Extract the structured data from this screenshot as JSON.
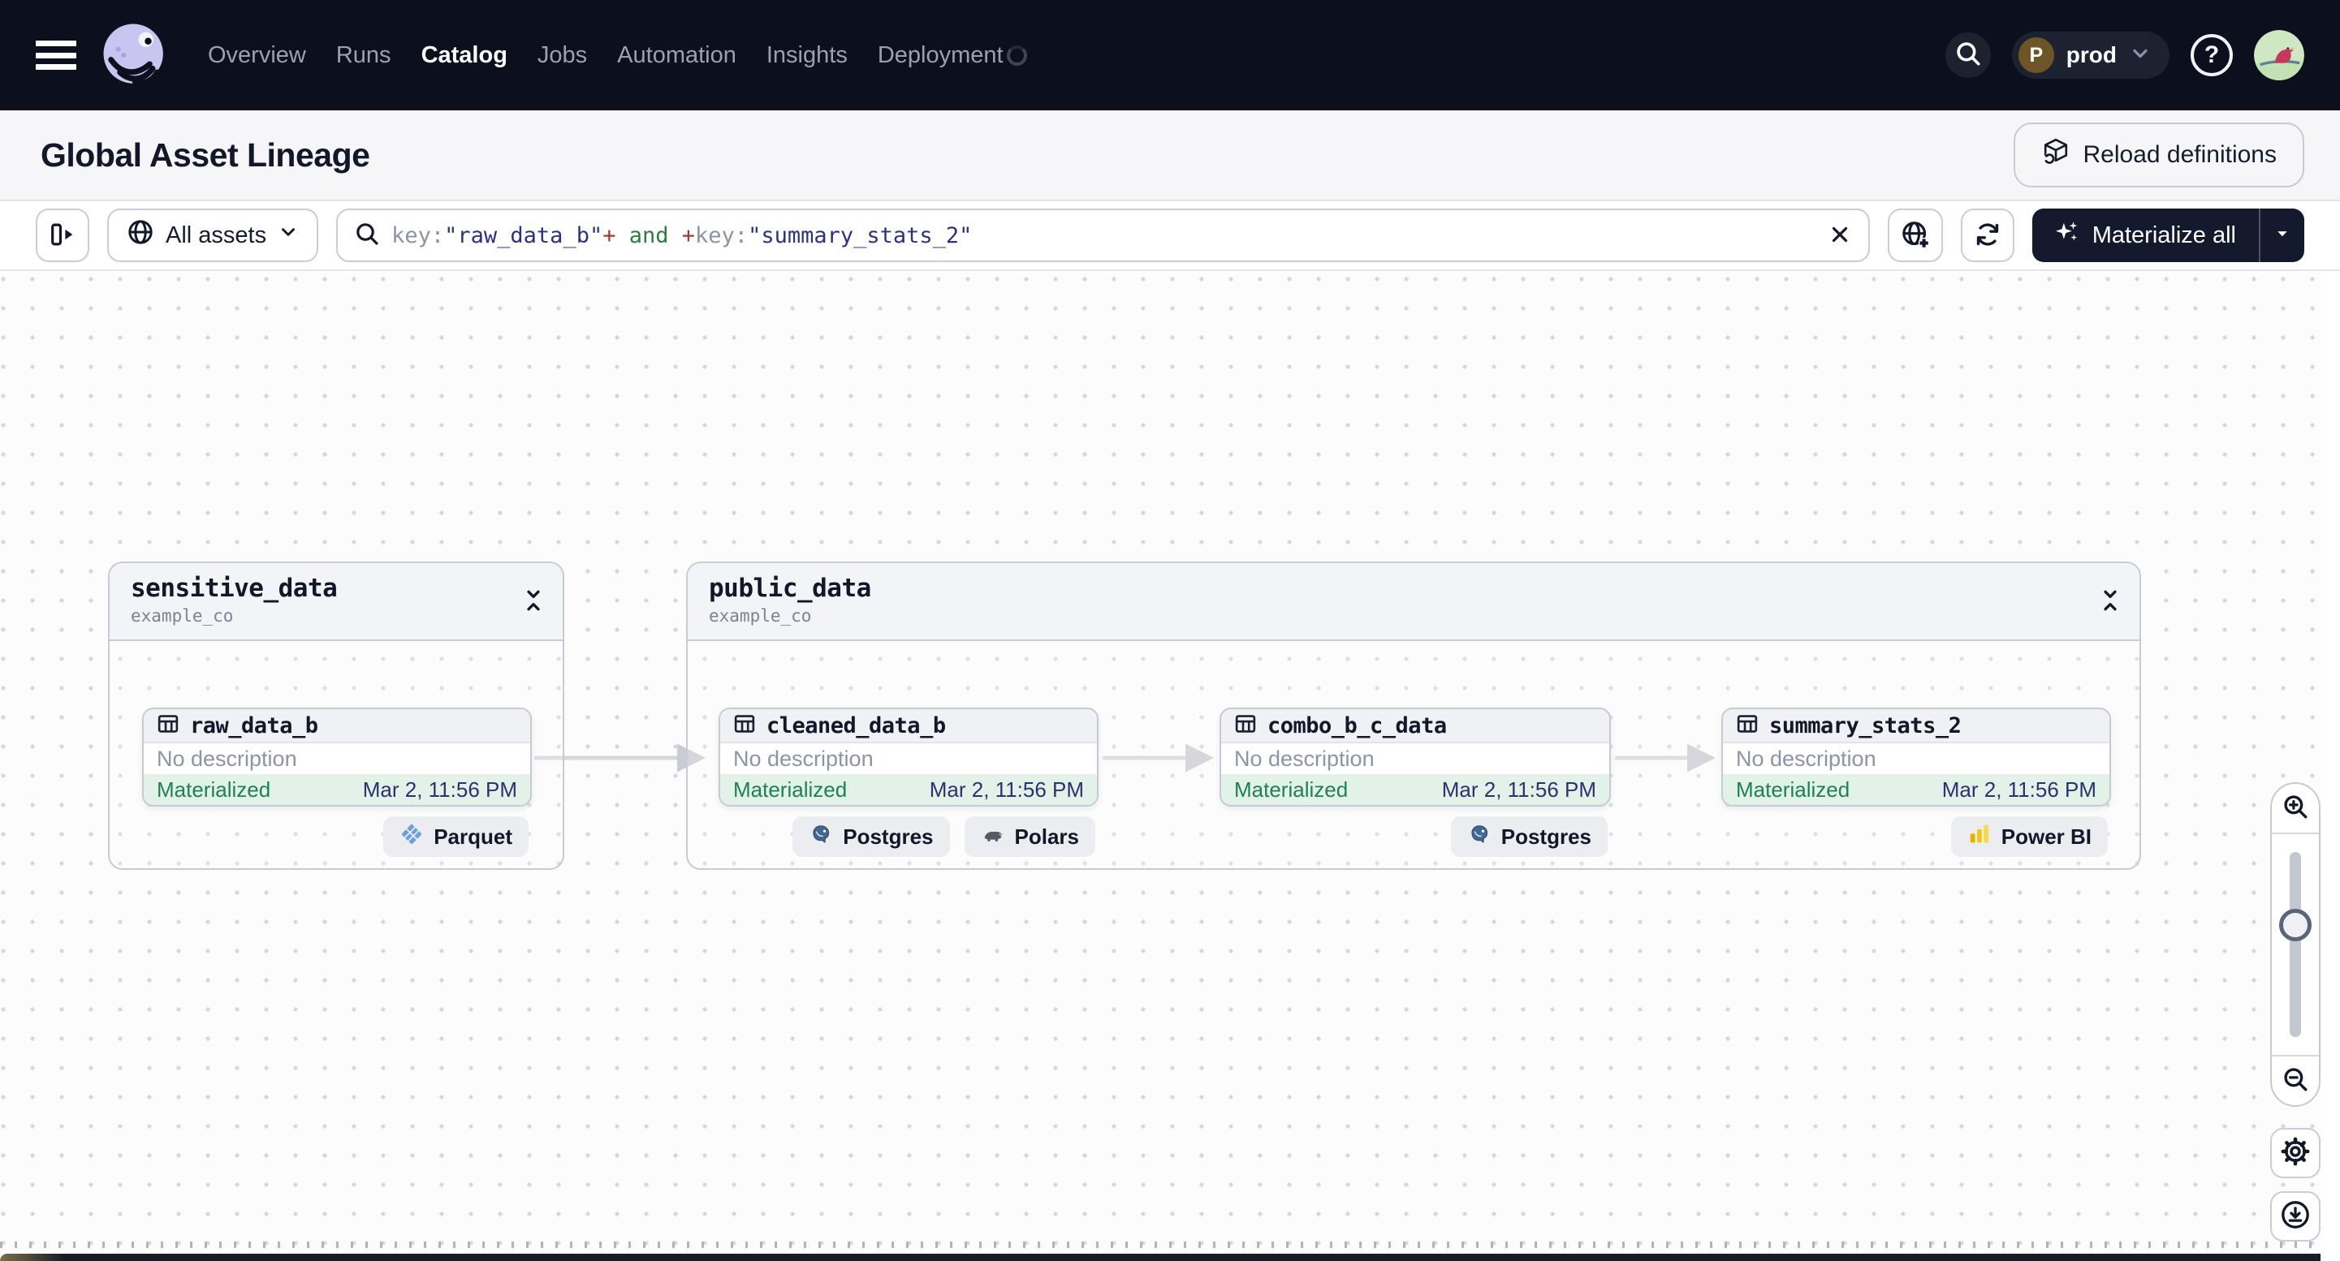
{
  "topnav": {
    "nav_items": [
      {
        "label": "Overview",
        "active": false
      },
      {
        "label": "Runs",
        "active": false
      },
      {
        "label": "Catalog",
        "active": true
      },
      {
        "label": "Jobs",
        "active": false
      },
      {
        "label": "Automation",
        "active": false
      },
      {
        "label": "Insights",
        "active": false
      },
      {
        "label": "Deployment",
        "active": false
      }
    ],
    "environment": {
      "label": "prod",
      "avatar_letter": "P"
    },
    "help_glyph": "?"
  },
  "page_header": {
    "title": "Global Asset Lineage",
    "reload_button_label": "Reload definitions"
  },
  "toolbar": {
    "scope_selector_label": "All assets",
    "search": {
      "tokens": [
        {
          "text": "key:",
          "color": "#8b93a5"
        },
        {
          "text": "\"raw_data_b\"",
          "color": "#2d3280"
        },
        {
          "text": "+",
          "color": "#a03a2c"
        },
        {
          "text": " and ",
          "color": "#2e7d43"
        },
        {
          "text": "+",
          "color": "#a03a2c"
        },
        {
          "text": "key:",
          "color": "#8b93a5"
        },
        {
          "text": "\"summary_stats_2\"",
          "color": "#2d3280"
        }
      ]
    },
    "materialize_button_label": "Materialize all"
  },
  "lineage": {
    "groups": [
      {
        "name": "sensitive_data",
        "location": "example_co",
        "assets": [
          {
            "name": "raw_data_b",
            "description": "No description",
            "status": "Materialized",
            "status_time": "Mar 2, 11:56 PM",
            "tags": [
              {
                "label": "Parquet",
                "icon": "parquet-icon"
              }
            ]
          }
        ]
      },
      {
        "name": "public_data",
        "location": "example_co",
        "assets": [
          {
            "name": "cleaned_data_b",
            "description": "No description",
            "status": "Materialized",
            "status_time": "Mar 2, 11:56 PM",
            "tags": [
              {
                "label": "Postgres",
                "icon": "postgres-icon"
              },
              {
                "label": "Polars",
                "icon": "polars-icon"
              }
            ]
          },
          {
            "name": "combo_b_c_data",
            "description": "No description",
            "status": "Materialized",
            "status_time": "Mar 2, 11:56 PM",
            "tags": [
              {
                "label": "Postgres",
                "icon": "postgres-icon"
              }
            ]
          },
          {
            "name": "summary_stats_2",
            "description": "No description",
            "status": "Materialized",
            "status_time": "Mar 2, 11:56 PM",
            "tags": [
              {
                "label": "Power BI",
                "icon": "powerbi-icon"
              }
            ]
          }
        ]
      }
    ]
  },
  "colors": {
    "topbar_bg": "#0c0f1d",
    "dark_button_bg": "#141a2e",
    "materialized_text": "#1f8150",
    "materialized_bg": "#e2f2e8",
    "timestamp_text": "#2c3270",
    "logo_lavender": "#c9c5f1"
  }
}
